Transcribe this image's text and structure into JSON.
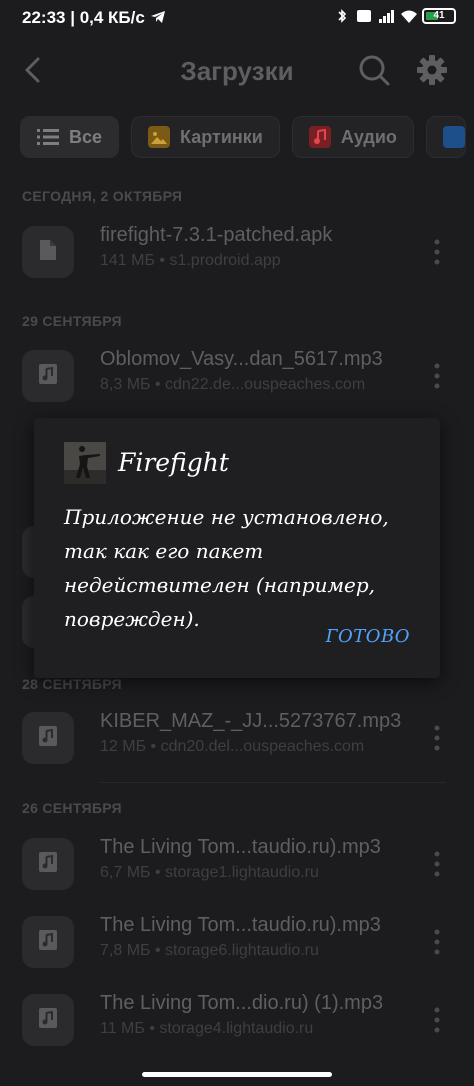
{
  "status_bar": {
    "time": "22:33",
    "speed": "| 0,4 КБ/с",
    "battery": "41"
  },
  "header": {
    "title": "Загрузки"
  },
  "filters": [
    {
      "label": "Все",
      "icon": "list-icon"
    },
    {
      "label": "Картинки",
      "icon": "image-icon"
    },
    {
      "label": "Аудио",
      "icon": "audio-icon"
    }
  ],
  "sections": [
    {
      "label": "СЕГОДНЯ, 2 ОКТЯБРЯ"
    },
    {
      "label": "29 СЕНТЯБРЯ"
    },
    {
      "label": "28 СЕНТЯБРЯ"
    },
    {
      "label": "26 СЕНТЯБРЯ"
    }
  ],
  "files": [
    {
      "name": "firefight-7.3.1-patched.apk",
      "meta": "141 МБ • s1.prodroid.app",
      "icon": "file-icon"
    },
    {
      "name": "Oblomov_Vasy...dan_5617.mp3",
      "meta": "8,3 МБ • cdn22.de...ouspeaches.com",
      "icon": "music-icon"
    },
    {
      "name": "KIBER_MAZ_-_JJ...5273767.mp3",
      "meta": "12 МБ • cdn20.del...ouspeaches.com",
      "icon": "music-icon"
    },
    {
      "name": "The Living Tom...taudio.ru).mp3",
      "meta": "6,7 МБ • storage1.lightaudio.ru",
      "icon": "music-icon"
    },
    {
      "name": "The Living Tom...taudio.ru).mp3",
      "meta": "7,8 МБ • storage6.lightaudio.ru",
      "icon": "music-icon"
    },
    {
      "name": "The Living Tom...dio.ru) (1).mp3",
      "meta": "11 МБ • storage4.lightaudio.ru",
      "icon": "music-icon"
    }
  ],
  "dialog": {
    "title": "Firefight",
    "message": "Приложение не установлено, так как его пакет недействителен (например, поврежден).",
    "button": "ГОТОВО"
  },
  "colors": {
    "background": "#1c1c1e",
    "dialog_bg": "#1f1f21",
    "accent": "#4fa3ff"
  }
}
